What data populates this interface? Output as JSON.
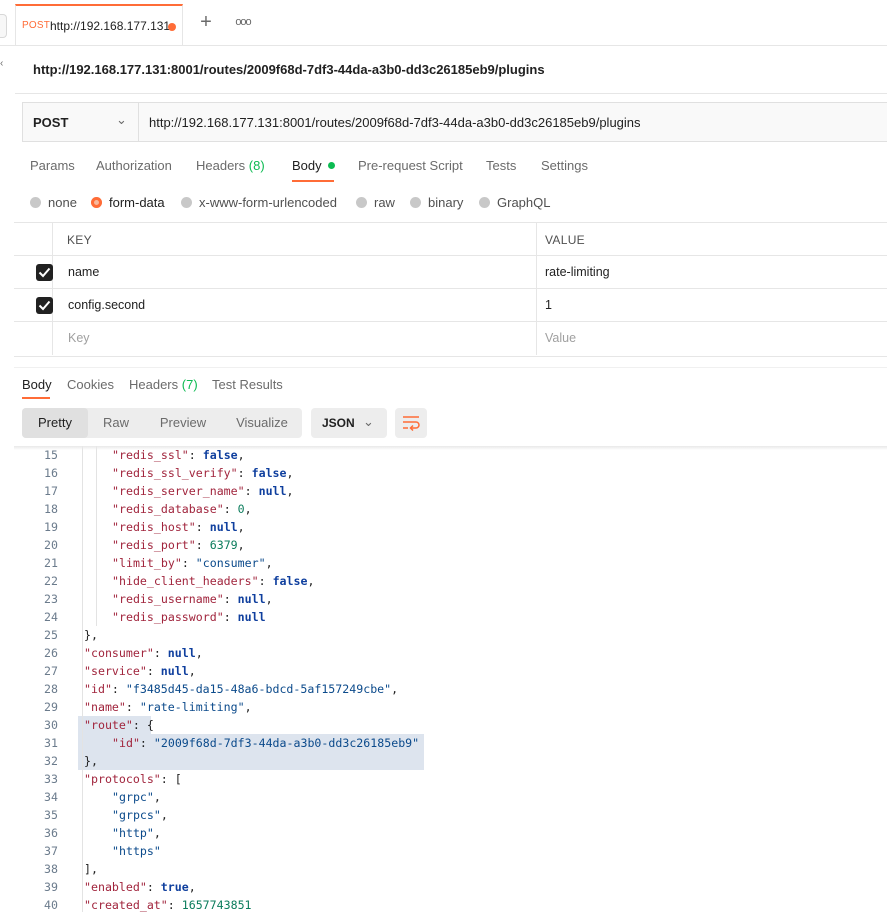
{
  "tab": {
    "method": "POST",
    "name": "http://192.168.177.131:"
  },
  "title": "http://192.168.177.131:8001/routes/2009f68d-7df3-44da-a3b0-dd3c26185eb9/plugins",
  "request": {
    "method": "POST",
    "url": "http://192.168.177.131:8001/routes/2009f68d-7df3-44da-a3b0-dd3c26185eb9/plugins"
  },
  "request_tabs": {
    "params": "Params",
    "authorization": "Authorization",
    "headers": "Headers",
    "headers_count": "(8)",
    "body": "Body",
    "prerequest": "Pre-request Script",
    "tests": "Tests",
    "settings": "Settings"
  },
  "body_types": {
    "none": "none",
    "form_data": "form-data",
    "urlencoded": "x-www-form-urlencoded",
    "raw": "raw",
    "binary": "binary",
    "graphql": "GraphQL",
    "selected": "form-data"
  },
  "table": {
    "key_header": "KEY",
    "value_header": "VALUE",
    "rows": [
      {
        "key": "name",
        "value": "rate-limiting",
        "checked": true
      },
      {
        "key": "config.second",
        "value": "1",
        "checked": true
      }
    ],
    "key_placeholder": "Key",
    "value_placeholder": "Value"
  },
  "response_tabs": {
    "body": "Body",
    "cookies": "Cookies",
    "headers": "Headers",
    "headers_count": "(7)",
    "test_results": "Test Results"
  },
  "view_modes": {
    "pretty": "Pretty",
    "raw": "Raw",
    "preview": "Preview",
    "visualize": "Visualize"
  },
  "format": "JSON",
  "code_lines": [
    {
      "n": "15",
      "indent": 2,
      "tokens": [
        [
          "k",
          "\"redis_ssl\""
        ],
        [
          "p",
          ": "
        ],
        [
          "b",
          "false"
        ],
        [
          "p",
          ","
        ]
      ]
    },
    {
      "n": "16",
      "indent": 2,
      "tokens": [
        [
          "k",
          "\"redis_ssl_verify\""
        ],
        [
          "p",
          ": "
        ],
        [
          "b",
          "false"
        ],
        [
          "p",
          ","
        ]
      ]
    },
    {
      "n": "17",
      "indent": 2,
      "tokens": [
        [
          "k",
          "\"redis_server_name\""
        ],
        [
          "p",
          ": "
        ],
        [
          "b",
          "null"
        ],
        [
          "p",
          ","
        ]
      ]
    },
    {
      "n": "18",
      "indent": 2,
      "tokens": [
        [
          "k",
          "\"redis_database\""
        ],
        [
          "p",
          ": "
        ],
        [
          "n",
          "0"
        ],
        [
          "p",
          ","
        ]
      ]
    },
    {
      "n": "19",
      "indent": 2,
      "tokens": [
        [
          "k",
          "\"redis_host\""
        ],
        [
          "p",
          ": "
        ],
        [
          "b",
          "null"
        ],
        [
          "p",
          ","
        ]
      ]
    },
    {
      "n": "20",
      "indent": 2,
      "tokens": [
        [
          "k",
          "\"redis_port\""
        ],
        [
          "p",
          ": "
        ],
        [
          "n",
          "6379"
        ],
        [
          "p",
          ","
        ]
      ]
    },
    {
      "n": "21",
      "indent": 2,
      "tokens": [
        [
          "k",
          "\"limit_by\""
        ],
        [
          "p",
          ": "
        ],
        [
          "s",
          "\"consumer\""
        ],
        [
          "p",
          ","
        ]
      ]
    },
    {
      "n": "22",
      "indent": 2,
      "tokens": [
        [
          "k",
          "\"hide_client_headers\""
        ],
        [
          "p",
          ": "
        ],
        [
          "b",
          "false"
        ],
        [
          "p",
          ","
        ]
      ]
    },
    {
      "n": "23",
      "indent": 2,
      "tokens": [
        [
          "k",
          "\"redis_username\""
        ],
        [
          "p",
          ": "
        ],
        [
          "b",
          "null"
        ],
        [
          "p",
          ","
        ]
      ]
    },
    {
      "n": "24",
      "indent": 2,
      "tokens": [
        [
          "k",
          "\"redis_password\""
        ],
        [
          "p",
          ": "
        ],
        [
          "b",
          "null"
        ]
      ]
    },
    {
      "n": "25",
      "indent": 1,
      "tokens": [
        [
          "p",
          "},"
        ]
      ]
    },
    {
      "n": "26",
      "indent": 1,
      "tokens": [
        [
          "k",
          "\"consumer\""
        ],
        [
          "p",
          ": "
        ],
        [
          "b",
          "null"
        ],
        [
          "p",
          ","
        ]
      ]
    },
    {
      "n": "27",
      "indent": 1,
      "tokens": [
        [
          "k",
          "\"service\""
        ],
        [
          "p",
          ": "
        ],
        [
          "b",
          "null"
        ],
        [
          "p",
          ","
        ]
      ]
    },
    {
      "n": "28",
      "indent": 1,
      "tokens": [
        [
          "k",
          "\"id\""
        ],
        [
          "p",
          ": "
        ],
        [
          "s",
          "\"f3485d45-da15-48a6-bdcd-5af157249cbe\""
        ],
        [
          "p",
          ","
        ]
      ]
    },
    {
      "n": "29",
      "indent": 1,
      "tokens": [
        [
          "k",
          "\"name\""
        ],
        [
          "p",
          ": "
        ],
        [
          "s",
          "\"rate-limiting\""
        ],
        [
          "p",
          ","
        ]
      ]
    },
    {
      "n": "30",
      "indent": 1,
      "tokens": [
        [
          "k",
          "\"route\""
        ],
        [
          "p",
          ": {"
        ]
      ]
    },
    {
      "n": "31",
      "indent": 2,
      "tokens": [
        [
          "k",
          "\"id\""
        ],
        [
          "p",
          ": "
        ],
        [
          "s",
          "\"2009f68d-7df3-44da-a3b0-dd3c26185eb9\""
        ]
      ]
    },
    {
      "n": "32",
      "indent": 1,
      "tokens": [
        [
          "p",
          "},"
        ]
      ]
    },
    {
      "n": "33",
      "indent": 1,
      "tokens": [
        [
          "k",
          "\"protocols\""
        ],
        [
          "p",
          ": ["
        ]
      ]
    },
    {
      "n": "34",
      "indent": 2,
      "tokens": [
        [
          "s",
          "\"grpc\""
        ],
        [
          "p",
          ","
        ]
      ]
    },
    {
      "n": "35",
      "indent": 2,
      "tokens": [
        [
          "s",
          "\"grpcs\""
        ],
        [
          "p",
          ","
        ]
      ]
    },
    {
      "n": "36",
      "indent": 2,
      "tokens": [
        [
          "s",
          "\"http\""
        ],
        [
          "p",
          ","
        ]
      ]
    },
    {
      "n": "37",
      "indent": 2,
      "tokens": [
        [
          "s",
          "\"https\""
        ]
      ]
    },
    {
      "n": "38",
      "indent": 1,
      "tokens": [
        [
          "p",
          "],"
        ]
      ]
    },
    {
      "n": "39",
      "indent": 1,
      "tokens": [
        [
          "k",
          "\"enabled\""
        ],
        [
          "p",
          ": "
        ],
        [
          "b",
          "true"
        ],
        [
          "p",
          ","
        ]
      ]
    },
    {
      "n": "40",
      "indent": 1,
      "tokens": [
        [
          "k",
          "\"created_at\""
        ],
        [
          "p",
          ": "
        ],
        [
          "n",
          "1657743851"
        ]
      ]
    }
  ],
  "colors": {
    "accent": "#ff6c37",
    "count_green": "#0cbb52"
  }
}
